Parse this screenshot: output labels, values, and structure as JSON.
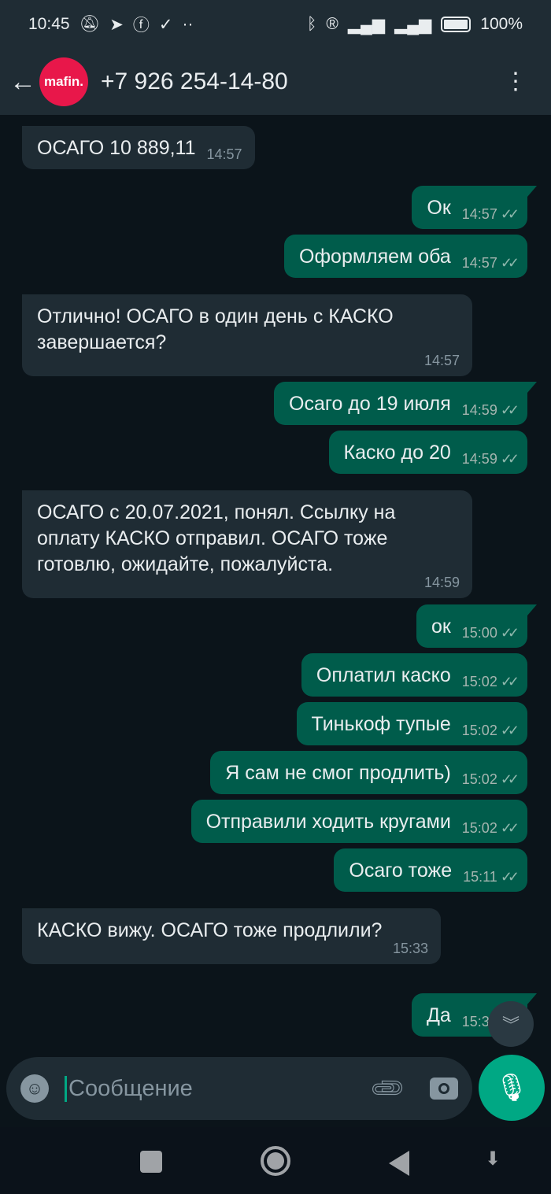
{
  "status_bar": {
    "time": "10:45",
    "battery": "100%",
    "icons": [
      "mute-icon",
      "telegram-icon",
      "facebook-icon",
      "check-circle-icon",
      "bluetooth-icon",
      "roaming-icon",
      "signal-icon",
      "4g-signal-icon",
      "battery-icon"
    ]
  },
  "header": {
    "contact": "+7 926 254-14-80",
    "avatar_text": "mafin.",
    "avatar_color": "#e8174a"
  },
  "messages": [
    {
      "dir": "in",
      "text": "ОСАГО 10 889,11",
      "time": "14:57"
    },
    {
      "dir": "out",
      "text": "Ок",
      "time": "14:57"
    },
    {
      "dir": "out",
      "text": "Оформляем оба",
      "time": "14:57"
    },
    {
      "dir": "in",
      "text": "Отлично! ОСАГО в один день с КАСКО завершается?",
      "time": "14:57"
    },
    {
      "dir": "out",
      "text": "Осаго до 19 июля",
      "time": "14:59"
    },
    {
      "dir": "out",
      "text": "Каско до 20",
      "time": "14:59"
    },
    {
      "dir": "in",
      "text": "ОСАГО с 20.07.2021, понял. Ссылку на оплату КАСКО отправил. ОСАГО тоже готовлю, ожидайте, пожалуйста.",
      "time": "14:59"
    },
    {
      "dir": "out",
      "text": "ок",
      "time": "15:00"
    },
    {
      "dir": "out",
      "text": "Оплатил каско",
      "time": "15:02"
    },
    {
      "dir": "out",
      "text": "Тинькоф тупые",
      "time": "15:02"
    },
    {
      "dir": "out",
      "text": "Я сам не смог продлить)",
      "time": "15:02"
    },
    {
      "dir": "out",
      "text": "Отправили ходить кругами",
      "time": "15:02"
    },
    {
      "dir": "out",
      "text": "Осаго тоже",
      "time": "15:11"
    },
    {
      "dir": "in",
      "text": "КАСКО вижу. ОСАГО тоже продлили?",
      "time": "15:33"
    },
    {
      "dir": "out",
      "text": "Да",
      "time": "15:34"
    }
  ],
  "composer": {
    "placeholder": "Сообщение"
  },
  "colors": {
    "outgoing": "#005c4b",
    "incoming": "#1f2c34",
    "accent": "#00a884"
  }
}
